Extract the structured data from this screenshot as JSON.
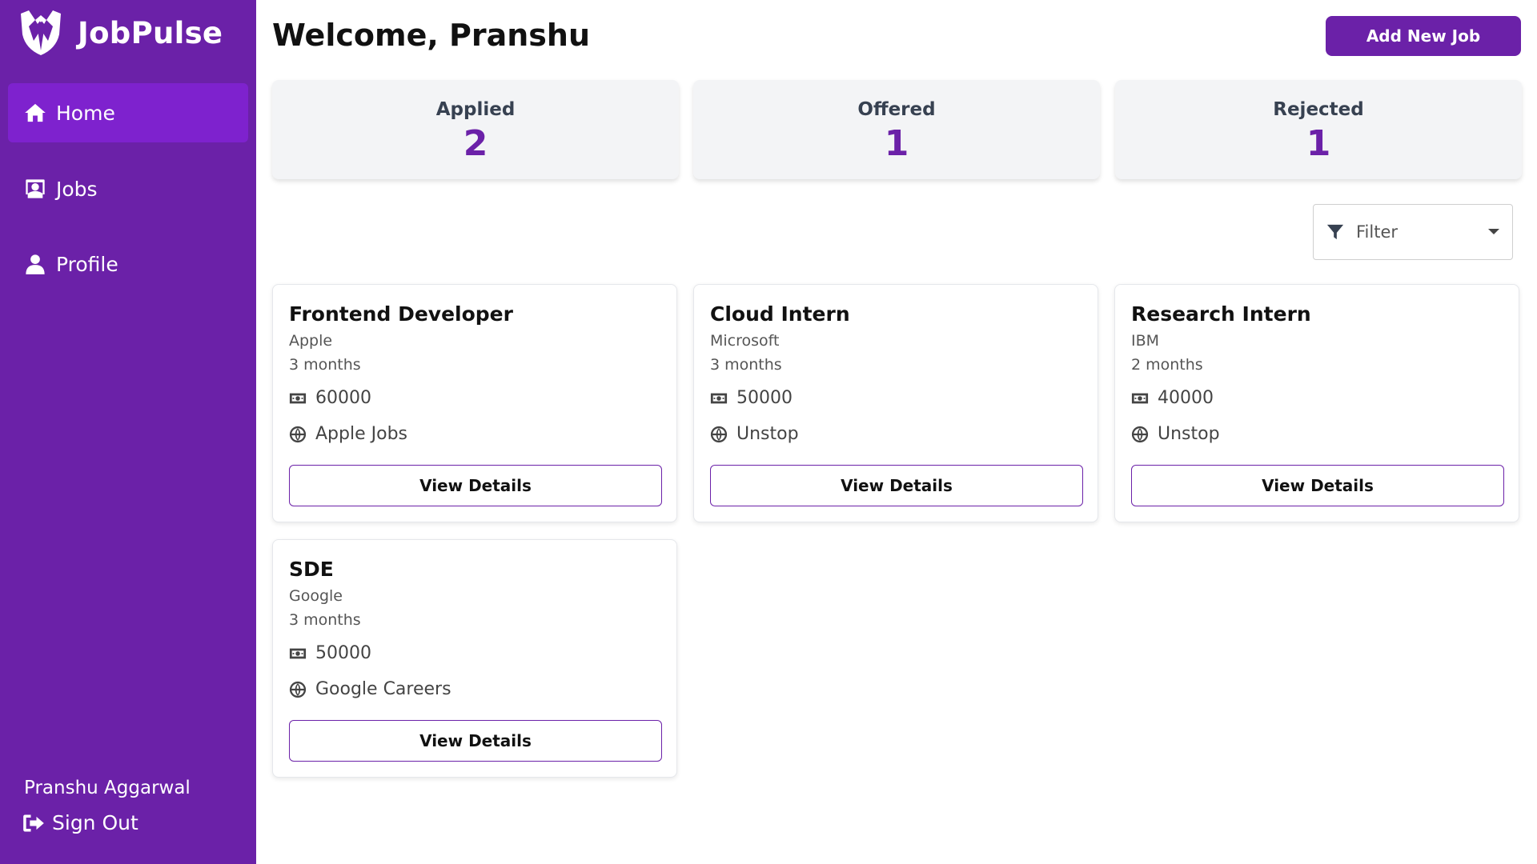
{
  "brand": {
    "name": "JobPulse",
    "logo_icon": "tuxedo-logo-icon"
  },
  "colors": {
    "primary": "#6b21a8",
    "active_nav": "#7e22ce",
    "stat_bg": "#f3f4f6"
  },
  "sidebar": {
    "items": [
      {
        "label": "Home",
        "icon": "home-icon",
        "active": true
      },
      {
        "label": "Jobs",
        "icon": "jobs-icon",
        "active": false
      },
      {
        "label": "Profile",
        "icon": "user-icon",
        "active": false
      }
    ],
    "user_name": "Pranshu Aggarwal",
    "sign_out_label": "Sign Out"
  },
  "header": {
    "welcome": "Welcome, Pranshu",
    "add_job_label": "Add New Job"
  },
  "stats": [
    {
      "label": "Applied",
      "value": "2"
    },
    {
      "label": "Offered",
      "value": "1"
    },
    {
      "label": "Rejected",
      "value": "1"
    }
  ],
  "filter": {
    "label": "Filter",
    "icon": "filter-icon"
  },
  "jobs": [
    {
      "title": "Frontend Developer",
      "company": "Apple",
      "duration": "3 months",
      "salary": "60000",
      "source": "Apple Jobs",
      "button": "View Details"
    },
    {
      "title": "Cloud Intern",
      "company": "Microsoft",
      "duration": "3 months",
      "salary": "50000",
      "source": "Unstop",
      "button": "View Details"
    },
    {
      "title": "Research Intern",
      "company": "IBM",
      "duration": "2 months",
      "salary": "40000",
      "source": "Unstop",
      "button": "View Details"
    },
    {
      "title": "SDE",
      "company": "Google",
      "duration": "3 months",
      "salary": "50000",
      "source": "Google Careers",
      "button": "View Details"
    }
  ]
}
